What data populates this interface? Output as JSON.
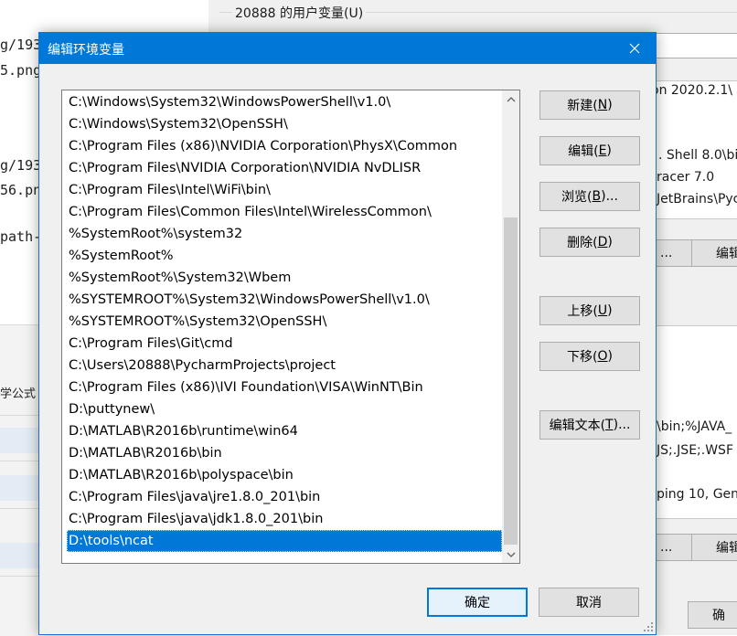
{
  "background_terminal": {
    "lines": [
      "g/193",
      "5.png",
      "g/193",
      "56.pn",
      "path-"
    ]
  },
  "background_left_panel": {
    "label": "学公式"
  },
  "parent_dialog": {
    "group_title": "20888 的用户变量(U)",
    "snippets": [
      "on 2020.2.1\\",
      ". Shell 8.0\\bi",
      "racer 7.0",
      "JetBrains\\Pyc",
      "\\bin;%JAVA_",
      "JS;.JSE;.WSF",
      "ping 10, Gen"
    ],
    "buttons": [
      "...",
      "编辑",
      "...",
      "编辑",
      "确"
    ]
  },
  "dialog": {
    "title": "编辑环境变量",
    "close_glyph": "✕",
    "path_entries": [
      "C:\\Windows\\System32\\WindowsPowerShell\\v1.0\\",
      "C:\\Windows\\System32\\OpenSSH\\",
      "C:\\Program Files (x86)\\NVIDIA Corporation\\PhysX\\Common",
      "C:\\Program Files\\NVIDIA Corporation\\NVIDIA NvDLISR",
      "C:\\Program Files\\Intel\\WiFi\\bin\\",
      "C:\\Program Files\\Common Files\\Intel\\WirelessCommon\\",
      "%SystemRoot%\\system32",
      "%SystemRoot%",
      "%SystemRoot%\\System32\\Wbem",
      "%SYSTEMROOT%\\System32\\WindowsPowerShell\\v1.0\\",
      "%SYSTEMROOT%\\System32\\OpenSSH\\",
      "C:\\Program Files\\Git\\cmd",
      "C:\\Users\\20888\\PycharmProjects\\project",
      "C:\\Program Files (x86)\\IVI Foundation\\VISA\\WinNT\\Bin",
      "D:\\puttynew\\",
      "D:\\MATLAB\\R2016b\\runtime\\win64",
      "D:\\MATLAB\\R2016b\\bin",
      "D:\\MATLAB\\R2016b\\polyspace\\bin",
      "C:\\Program Files\\java\\jre1.8.0_201\\bin",
      "C:\\Program Files\\java\\jdk1.8.0_201\\bin",
      "D:\\tools\\ncat"
    ],
    "selected_index": 20,
    "buttons": {
      "new": {
        "pre": "新建(",
        "key": "N",
        "post": ")"
      },
      "edit": {
        "pre": "编辑(",
        "key": "E",
        "post": ")"
      },
      "browse": {
        "pre": "浏览(",
        "key": "B",
        "post": ")..."
      },
      "delete": {
        "pre": "删除(",
        "key": "D",
        "post": ")"
      },
      "move_up": {
        "pre": "上移(",
        "key": "U",
        "post": ")"
      },
      "move_down": {
        "pre": "下移(",
        "key": "O",
        "post": ")"
      },
      "edit_text": {
        "pre": "编辑文本(",
        "key": "T",
        "post": ")..."
      },
      "ok": "确定",
      "cancel": "取消"
    },
    "colors": {
      "titlebar": "#0078d7",
      "selection": "#0078d7",
      "dialog_bg": "#f0f0f0",
      "button_bg": "#e1e1e1"
    }
  }
}
